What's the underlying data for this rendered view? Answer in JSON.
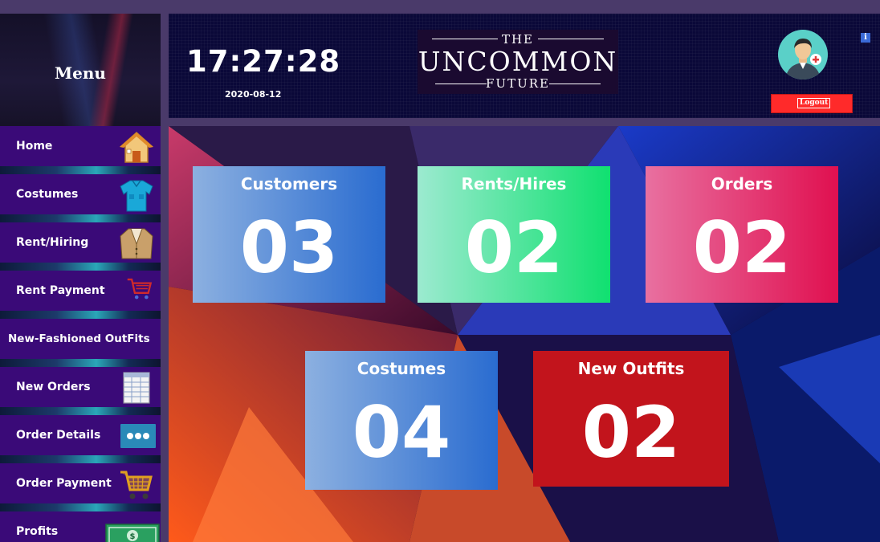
{
  "sidebar": {
    "title": "Menu",
    "items": [
      {
        "label": "Home",
        "icon": "house-icon"
      },
      {
        "label": "Costumes",
        "icon": "shirt-icon"
      },
      {
        "label": "Rent/Hiring",
        "icon": "suit-jacket-icon"
      },
      {
        "label": "Rent Payment",
        "icon": "shopping-cart-icon"
      },
      {
        "label": "New-Fashioned OutFits",
        "icon": ""
      },
      {
        "label": "New Orders",
        "icon": "spreadsheet-icon"
      },
      {
        "label": "Order Details",
        "icon": "more-dots-icon"
      },
      {
        "label": "Order Payment",
        "icon": "shopping-cart-icon"
      },
      {
        "label": "Profits",
        "icon": "money-stack-icon"
      }
    ]
  },
  "header": {
    "time": "17:27:28",
    "date": "2020-08-12",
    "logo": {
      "top": "THE",
      "main": "UNCOMMON",
      "bottom": "FUTURE"
    },
    "logout_label": "Logout",
    "info_label": "i"
  },
  "cards": {
    "customers": {
      "title": "Customers",
      "value": "03"
    },
    "rents": {
      "title": "Rents/Hires",
      "value": "02"
    },
    "orders": {
      "title": "Orders",
      "value": "02"
    },
    "costumes": {
      "title": "Costumes",
      "value": "04"
    },
    "new_outfits": {
      "title": "New Outfits",
      "value": "02"
    }
  },
  "colors": {
    "sidebar_item": "#3a0a78",
    "header_bg": "#0a0838",
    "logout": "#ff2a2a",
    "new_outfits_card": "#c2141c"
  }
}
